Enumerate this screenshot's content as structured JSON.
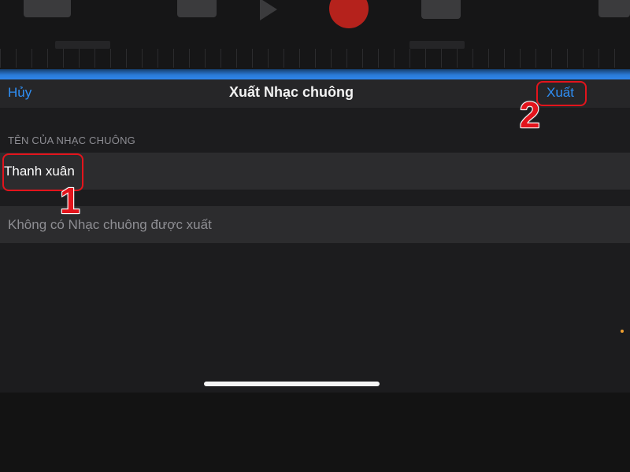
{
  "nav": {
    "cancel_label": "Hủy",
    "title": "Xuất Nhạc chuông",
    "export_label": "Xuất"
  },
  "form": {
    "section_header": "TÊN CỦA NHẠC CHUÔNG",
    "ringtone_name": "Thanh xuân",
    "no_ringtones_text": "Không có Nhạc chuông được xuất"
  },
  "annotations": {
    "step_1": "1",
    "step_2": "2"
  },
  "colors": {
    "accent": "#2f8ff5",
    "annotation": "#e3141c",
    "sheet_background": "#1c1c1e",
    "cell_background": "#2c2c2e"
  },
  "icons": [
    "record-icon",
    "play-icon"
  ]
}
